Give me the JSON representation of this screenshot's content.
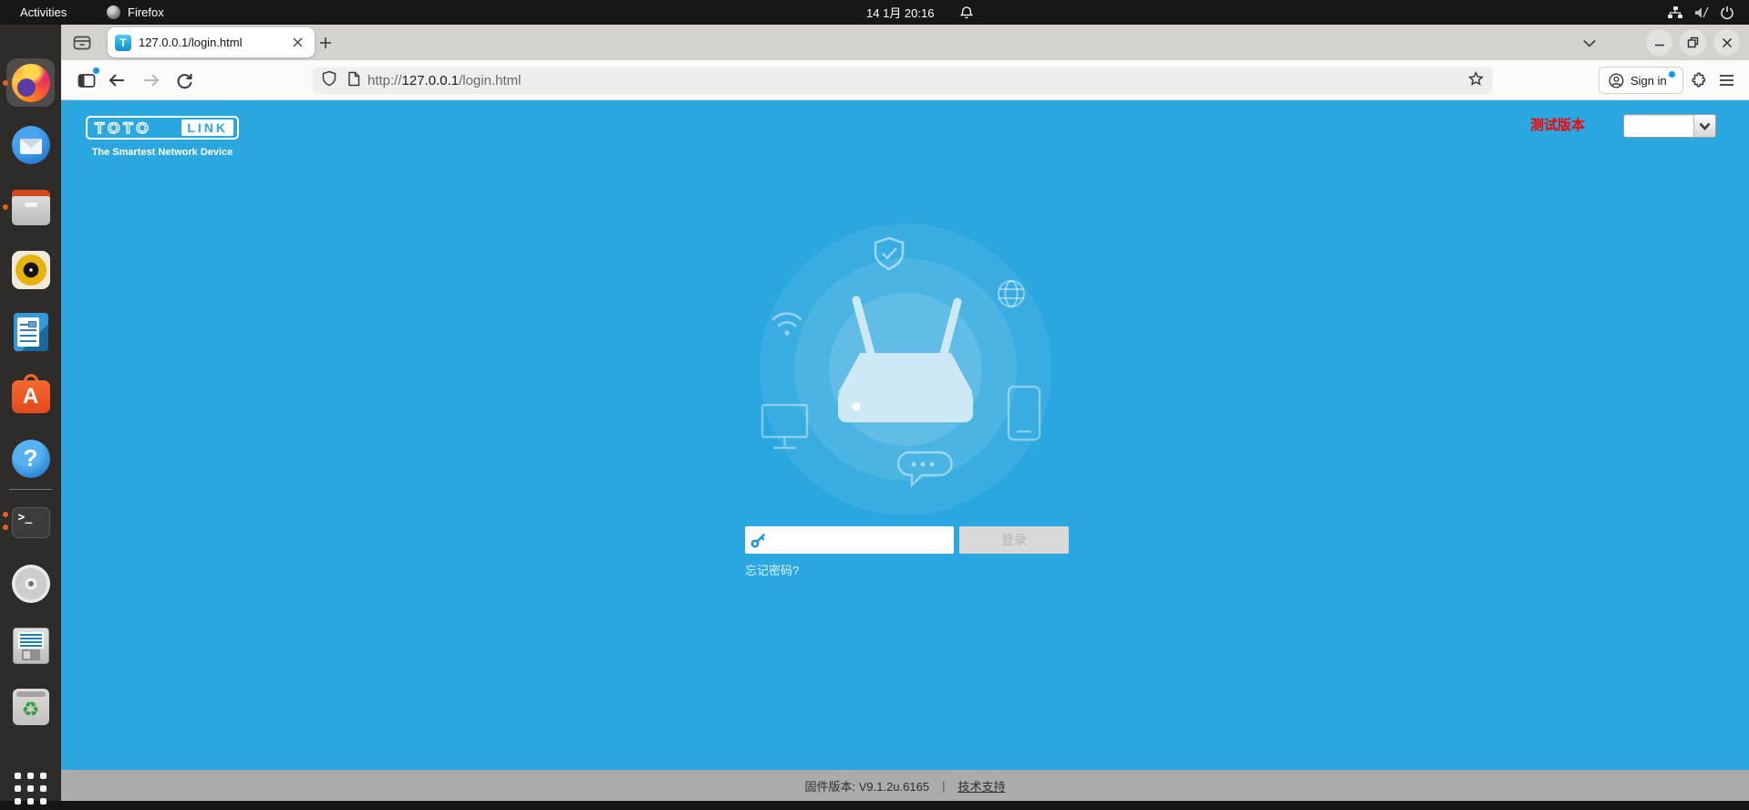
{
  "system_bar": {
    "activities": "Activities",
    "app_name": "Firefox",
    "clock": "14 1月 20:16",
    "status_icons": [
      "network-wired-icon",
      "volume-muted-icon",
      "power-icon"
    ]
  },
  "dock": {
    "items": [
      {
        "id": "firefox",
        "active": true,
        "running_indicators": 1
      },
      {
        "id": "thunderbird",
        "running_indicators": 0
      },
      {
        "id": "files",
        "running_indicators": 1
      },
      {
        "id": "rhythmbox",
        "running_indicators": 0
      },
      {
        "id": "libreoffice-writer",
        "running_indicators": 0
      },
      {
        "id": "app-center",
        "running_indicators": 0
      },
      {
        "id": "help",
        "running_indicators": 0
      },
      {
        "id": "terminal",
        "running_indicators": 2
      },
      {
        "id": "disc",
        "running_indicators": 0
      },
      {
        "id": "floppy",
        "running_indicators": 0
      },
      {
        "id": "trash",
        "running_indicators": 0
      },
      {
        "id": "show-applications",
        "running_indicators": 0
      }
    ]
  },
  "browser": {
    "tab": {
      "title": "127.0.0.1/login.html",
      "favicon_letter": "T"
    },
    "url": {
      "scheme": "http://",
      "host": "127.0.0.1",
      "path": "/login.html"
    },
    "sign_in_label": "Sign in"
  },
  "page": {
    "logo": {
      "primary": "TOTO",
      "secondary": "LINK",
      "tagline": "The Smartest Network Device"
    },
    "version_badge": "测试版本",
    "language_select": {
      "selected_value": ""
    },
    "login": {
      "submit_label": "登录",
      "forgot_password_label": "忘记密码?"
    },
    "footer": {
      "firmware": "固件版本: V9.1.2u.6165",
      "divider": "|",
      "support_link": "技术支持"
    }
  },
  "colors": {
    "page_background": "#2BA7DF",
    "footer_background": "#ABABAB",
    "version_badge_color": "#FF0000",
    "key_icon_color": "#1799D4",
    "login_button_bg": "#D9D9D9",
    "login_button_text": "#B2B2B2"
  }
}
